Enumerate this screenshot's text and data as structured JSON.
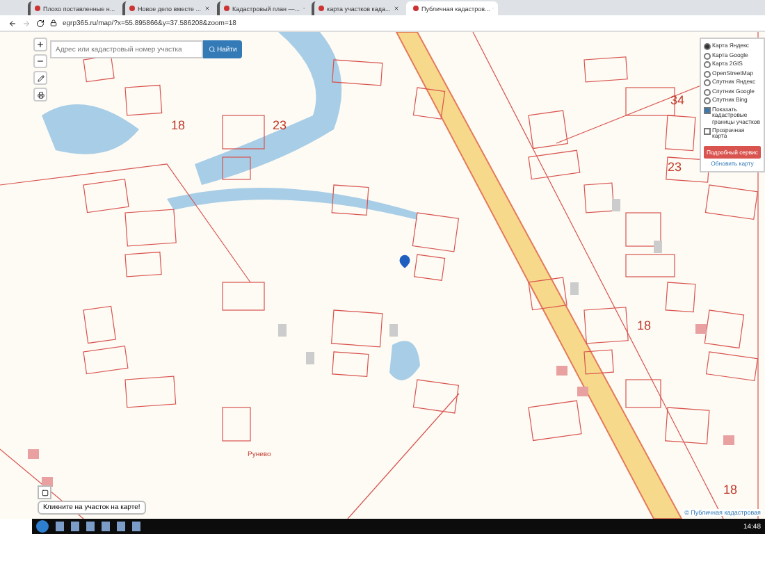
{
  "browser": {
    "tabs": [
      {
        "title": "Плохо поставленные н...",
        "selected": false
      },
      {
        "title": "Новое дело вместе ...",
        "selected": false
      },
      {
        "title": "Кадастровый план —...",
        "selected": false
      },
      {
        "title": "карта участков када...",
        "selected": false
      },
      {
        "title": "Публичная кадастров...",
        "selected": true
      }
    ],
    "address": "egrp365.ru/map/?x=55.895866&y=37.586208&zoom=18"
  },
  "search": {
    "placeholder": "Адрес или кадастровый номер участка",
    "button": "Найти"
  },
  "layers": {
    "options": [
      {
        "label": "Карта Яндекс",
        "selected": true
      },
      {
        "label": "Карта Google",
        "selected": false
      },
      {
        "label": "Карта 2GIS",
        "selected": false
      },
      {
        "label": "OpenStreetMap",
        "selected": false
      },
      {
        "label": "Спутник Яндекс",
        "selected": false
      },
      {
        "label": "Спутник Google",
        "selected": false
      },
      {
        "label": "Спутник Bing",
        "selected": false
      }
    ],
    "toggles": [
      {
        "label": "Показать кадастровые границы участков",
        "checked": true
      },
      {
        "label": "Прозрачная карта",
        "checked": false
      }
    ],
    "button": "Подробный сервис",
    "link": "Обновить карту"
  },
  "map_labels": [
    "18",
    "23",
    "34",
    "23",
    "18",
    "18",
    "Рунево"
  ],
  "hint": "Кликните на участок на карте!",
  "attribution": "© Публичная кадастровая",
  "taskbar": {
    "clock": "14:48"
  }
}
